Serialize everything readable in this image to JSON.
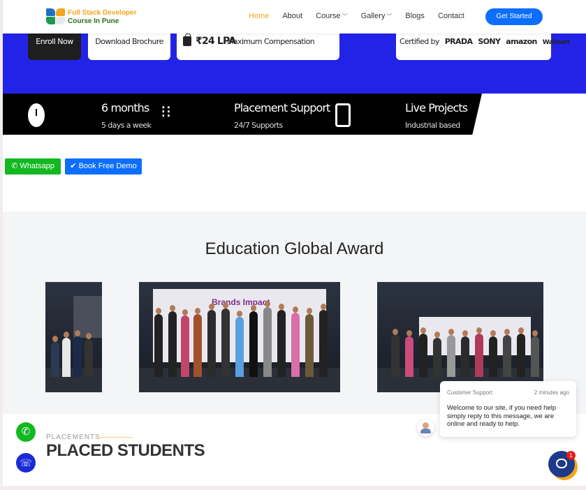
{
  "header": {
    "logo_line1": "Full Stack Developer",
    "logo_line2": "Course In Pune",
    "nav": [
      {
        "label": "Home",
        "active": true
      },
      {
        "label": "About"
      },
      {
        "label": "Course",
        "dropdown": true
      },
      {
        "label": "Gallery",
        "dropdown": true
      },
      {
        "label": "Blogs"
      },
      {
        "label": "Contact"
      }
    ],
    "cta_label": "Get Started"
  },
  "hero": {
    "enroll_label": "Enroll Now",
    "brochure_label": "Download Brochure",
    "lpa_value": "₹24 LPA",
    "lpa_sub": "Maximum Compensation",
    "certified_label": "Certified by",
    "brands": [
      "PRADA",
      "SONY",
      "amazon",
      "Walmart"
    ]
  },
  "features": [
    {
      "title": "6 months",
      "sub": "5 days a week",
      "icon": "clock-icon"
    },
    {
      "title": "Placement Support",
      "sub": "24/7 Supports",
      "icon": "footsteps-icon"
    },
    {
      "title": "Live Projects",
      "sub": "Industrial based",
      "icon": "microphone-icon"
    }
  ],
  "actions": {
    "whatsapp_label": "Whatsapp",
    "demo_label": "Book Free Demo"
  },
  "award": {
    "title": "Education Global Award",
    "backdrop_brand": "Brands Impact"
  },
  "placements": {
    "label": "PLACEMENTS",
    "title": "PLACED STUDENTS"
  },
  "chat": {
    "sender": "Customer Support",
    "time": "2 minutes ago",
    "message": "Welcome to our site, if you need help simply reply to this message, we are online and ready to help.",
    "badge_count": "1"
  },
  "colors": {
    "accent": "#f4a51c",
    "primary": "#0d6efd",
    "hero_blue": "#2323e8",
    "whatsapp": "#12b820"
  }
}
